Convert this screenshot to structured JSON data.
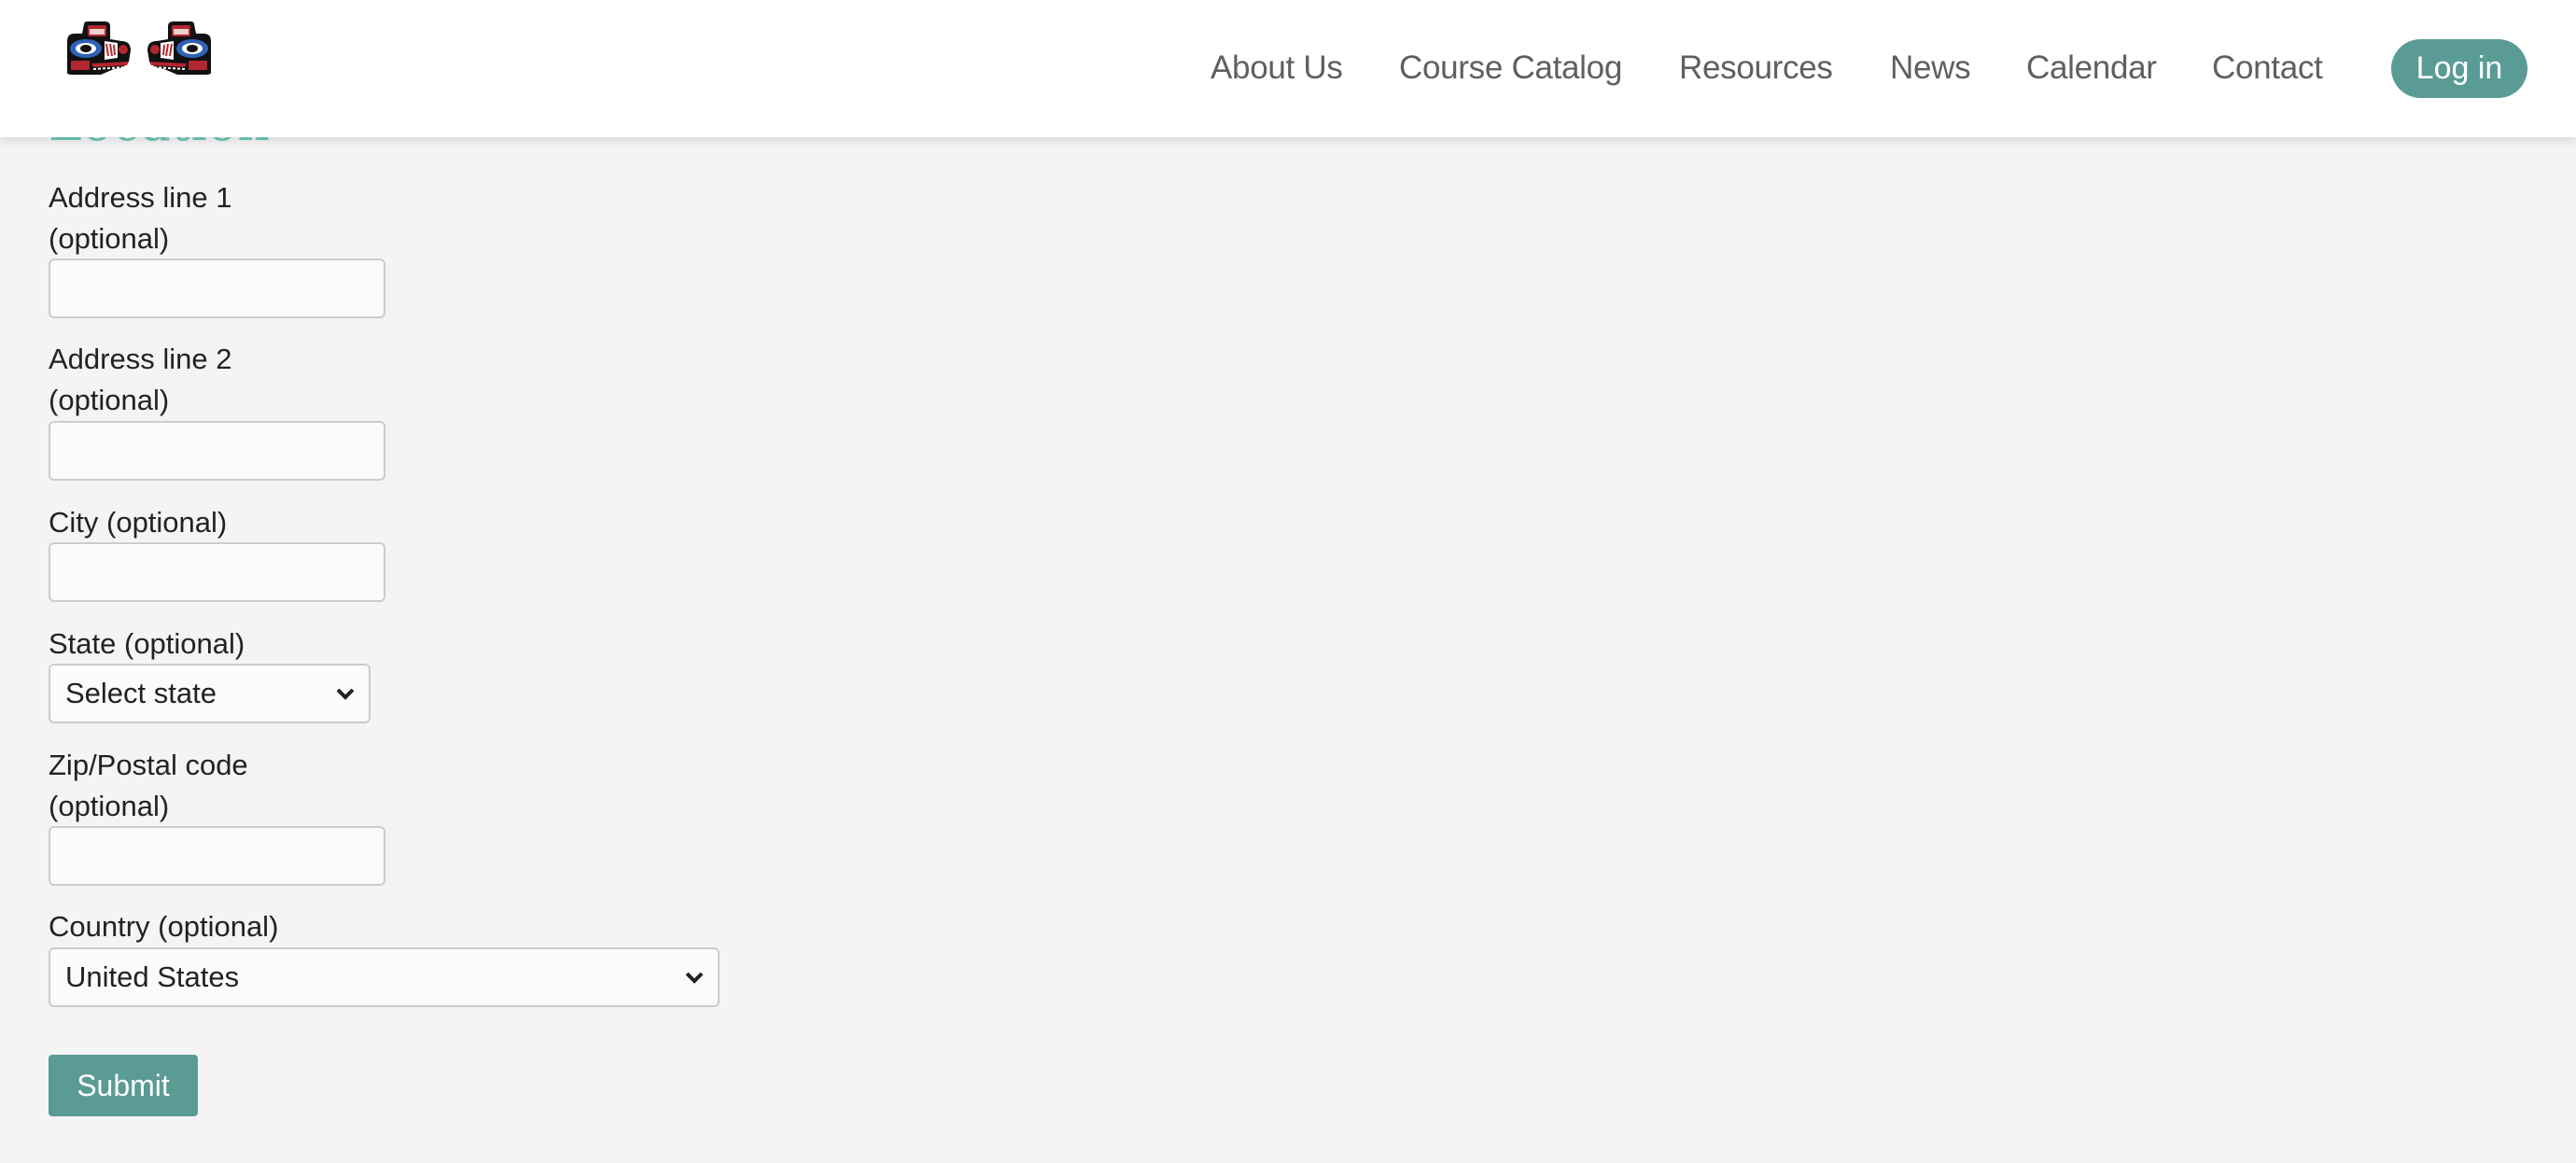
{
  "header": {
    "logo_alt": "Formline logo",
    "nav": [
      {
        "label": "About Us"
      },
      {
        "label": "Course Catalog"
      },
      {
        "label": "Resources"
      },
      {
        "label": "News"
      },
      {
        "label": "Calendar"
      },
      {
        "label": "Contact"
      }
    ],
    "login_label": "Log in",
    "accent_color": "#5b9b96"
  },
  "form": {
    "section_title": "Location",
    "fields": [
      {
        "label_lines": [
          "Address line 1",
          "(optional)"
        ],
        "value": ""
      },
      {
        "label_lines": [
          "Address line 2",
          "(optional)"
        ],
        "value": ""
      },
      {
        "label_lines": [
          "City (optional)"
        ],
        "value": ""
      },
      {
        "label_lines": [
          "State (optional)"
        ],
        "selected": "Select state"
      },
      {
        "label_lines": [
          "Zip/Postal code",
          "(optional)"
        ],
        "value": ""
      },
      {
        "label_lines": [
          "Country (optional)"
        ],
        "selected": "United States"
      }
    ],
    "submit_label": "Submit"
  }
}
